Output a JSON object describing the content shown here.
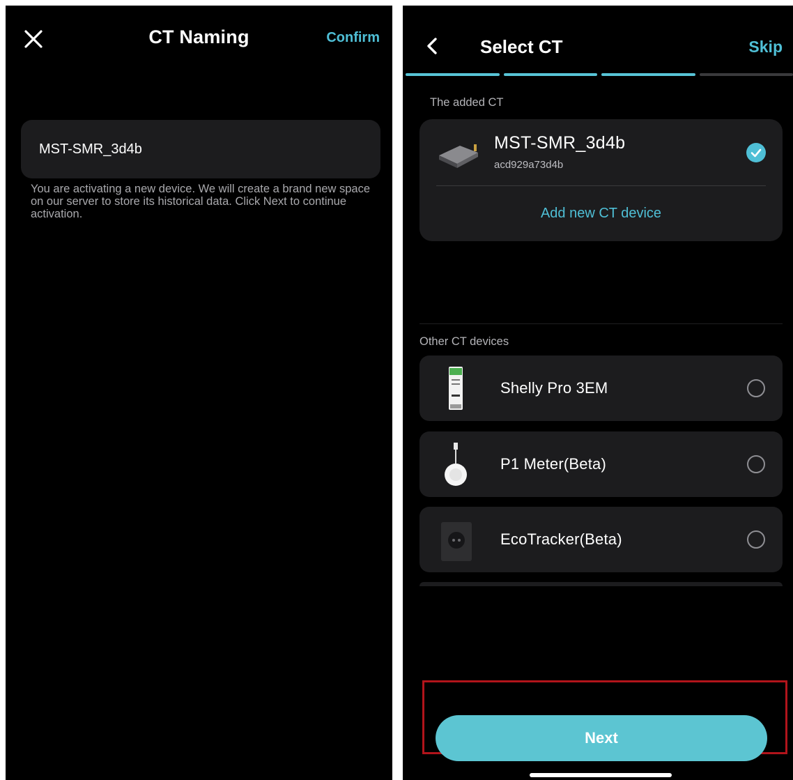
{
  "naming_screen": {
    "close_icon": "close-icon",
    "title": "CT Naming",
    "confirm_label": "Confirm",
    "device_name_value": "MST-SMR_3d4b",
    "hint": "You are activating a new device. We will create a brand new space on our server to store its historical data. Click Next to continue activation."
  },
  "select_screen": {
    "back_icon": "chevron-left-icon",
    "title": "Select CT",
    "skip_label": "Skip",
    "progress": {
      "total_steps": 4,
      "completed_steps": 3
    },
    "added_section_label": "The added CT",
    "added_device": {
      "name": "MST-SMR_3d4b",
      "id": "acd929a73d4b",
      "selected": true
    },
    "add_new_label": "Add new CT device",
    "other_section_label": "Other CT devices",
    "other_devices": [
      {
        "name": "Shelly Pro 3EM",
        "icon": "shelly-meter-icon",
        "selected": false
      },
      {
        "name": "P1 Meter(Beta)",
        "icon": "p1-meter-icon",
        "selected": false
      },
      {
        "name": "EcoTracker(Beta)",
        "icon": "ecotracker-icon",
        "selected": false
      }
    ],
    "next_label": "Next"
  },
  "colors": {
    "accent": "#4fbfd6",
    "next_button": "#5cc5d2",
    "card": "#1c1c1e",
    "highlight_border": "#b1141b"
  }
}
